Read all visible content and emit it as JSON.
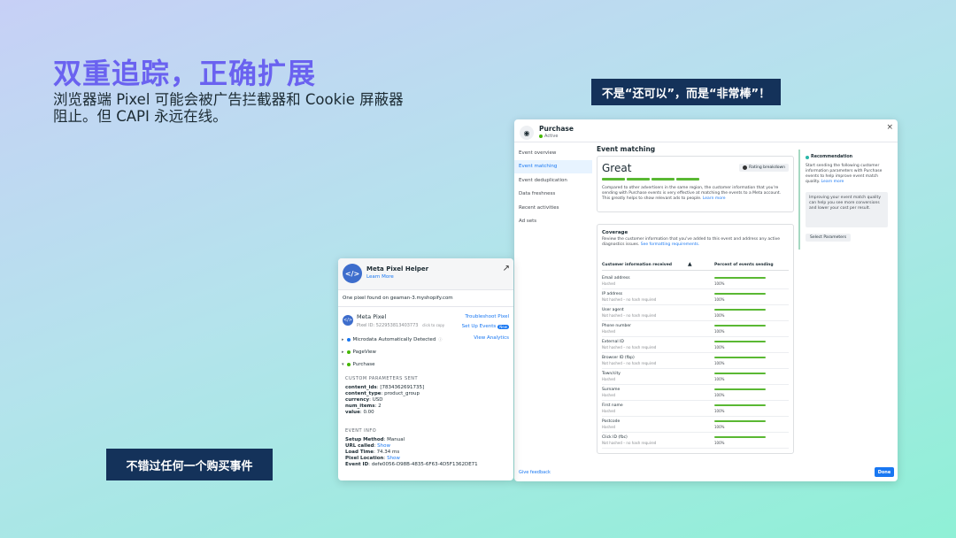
{
  "headline": "双重追踪，正确扩展",
  "subhead": "浏览器端 Pixel 可能会被广告拦截器和 Cookie 屏蔽器阻止。但 CAPI 永远在线。",
  "callout_top": "不是“还可以”，而是“非常棒”！",
  "callout_bottom": "不错过任何一个购买事件",
  "event_manager": {
    "title": "Purchase",
    "status": "Active",
    "close": "×",
    "nav": [
      "Event overview",
      "Event matching",
      "Event deduplication",
      "Data freshness",
      "Recent activities",
      "Ad sets"
    ],
    "nav_active": 1,
    "feedback": "Give feedback",
    "section_title": "Event matching",
    "rating": "Great",
    "rating_button": "Rating breakdown",
    "match_desc": "Compared to other advertisers in the same region, the customer information that you're sending with Purchase events is very effective at matching the events to a Meta account. This greatly helps to show relevant ads to people.",
    "learn_more": "Learn more",
    "coverage_title": "Coverage",
    "coverage_desc": "Review the customer information that you've added to this event and address any active diagnostics issues.",
    "formatting_link": "See formatting requirements.",
    "col_info": "Customer information received",
    "col_percent": "Percent of events sending",
    "rows": [
      {
        "name": "Email address",
        "sub": "Hashed",
        "pct": "100%",
        "value": 100
      },
      {
        "name": "IP address",
        "sub": "Not hashed – no hash required",
        "pct": "100%",
        "value": 100
      },
      {
        "name": "User agent",
        "sub": "Not hashed – no hash required",
        "pct": "100%",
        "value": 100
      },
      {
        "name": "Phone number",
        "sub": "Hashed",
        "pct": "100%",
        "value": 100
      },
      {
        "name": "External ID",
        "sub": "Not hashed – no hash required",
        "pct": "100%",
        "value": 100
      },
      {
        "name": "Browser ID (fbp)",
        "sub": "Not hashed – no hash required",
        "pct": "100%",
        "value": 100
      },
      {
        "name": "Town/city",
        "sub": "Hashed",
        "pct": "100%",
        "value": 100
      },
      {
        "name": "Surname",
        "sub": "Hashed",
        "pct": "100%",
        "value": 100
      },
      {
        "name": "First name",
        "sub": "Hashed",
        "pct": "100%",
        "value": 100
      },
      {
        "name": "Postcode",
        "sub": "Hashed",
        "pct": "100%",
        "value": 100
      },
      {
        "name": "Click ID (fbc)",
        "sub": "Not hashed – no hash required",
        "pct": "100%",
        "value": 100
      }
    ],
    "reco_title": "Recommendation",
    "reco_desc": "Start sending the following customer information parameters with Purchase events to help improve event match quality.",
    "reco_box": "Improving your event match quality can help you see more conversions and lower your cost per result.",
    "reco_button": "Select Parameters",
    "done": "Done",
    "colors": {
      "accent": "#1877f2",
      "success": "#5ab833"
    }
  },
  "pixel_helper": {
    "title": "Meta Pixel Helper",
    "learn_more": "Learn More",
    "found": "One pixel found on geaman-3.myshopify.com",
    "pixel_name": "Meta Pixel",
    "pixel_id": "Pixel ID: 522953813403773",
    "click_copy": "click to copy",
    "troubleshoot": "Troubleshoot Pixel",
    "setup_events": "Set Up Events",
    "new_badge": "New",
    "view_analytics": "View Analytics",
    "events": [
      "Microdata Automatically Detected",
      "PageView",
      "Purchase"
    ],
    "custom_params_caption": "CUSTOM PARAMETERS SENT",
    "params": [
      {
        "key": "content_ids",
        "value": "[7834362691735]"
      },
      {
        "key": "content_type",
        "value": "product_group"
      },
      {
        "key": "currency",
        "value": "USD"
      },
      {
        "key": "num_items",
        "value": "2"
      },
      {
        "key": "value",
        "value": "0.00"
      }
    ],
    "event_info_caption": "EVENT INFO",
    "info": [
      {
        "key": "Setup Method",
        "value": "Manual",
        "link": false
      },
      {
        "key": "URL called",
        "value": "Show",
        "link": true
      },
      {
        "key": "Load Time",
        "value": "74.34 ms",
        "link": false
      },
      {
        "key": "Pixel Location",
        "value": "Show",
        "link": true
      },
      {
        "key": "Event ID",
        "value": "defe0056-D98B-4835-6F63-4D5F1362DE71",
        "link": false
      }
    ]
  }
}
